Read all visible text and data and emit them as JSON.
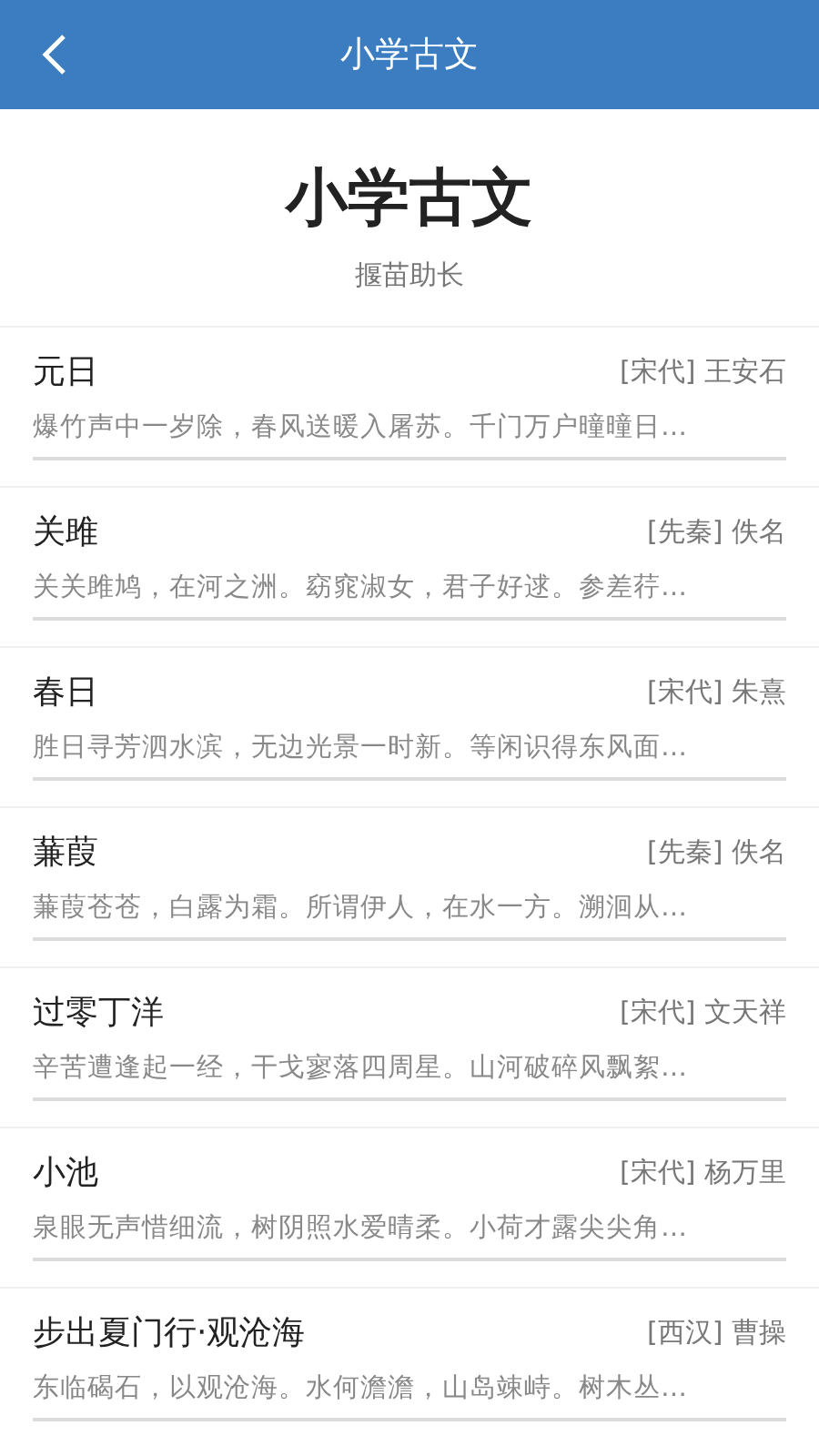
{
  "header": {
    "title": "小学古文"
  },
  "intro": {
    "title": "小学古文",
    "subtitle": "揠苗助长"
  },
  "poems": [
    {
      "title": "元日",
      "dynasty": "[宋代]",
      "author": "王安石",
      "excerpt": "爆竹声中一岁除，春风送暖入屠苏。千门万户曈曈日…"
    },
    {
      "title": "关雎",
      "dynasty": "[先秦]",
      "author": "佚名",
      "excerpt": "关关雎鸠，在河之洲。窈窕淑女，君子好逑。参差荇…"
    },
    {
      "title": "春日",
      "dynasty": "[宋代]",
      "author": "朱熹",
      "excerpt": "胜日寻芳泗水滨，无边光景一时新。等闲识得东风面…"
    },
    {
      "title": "蒹葭",
      "dynasty": "[先秦]",
      "author": "佚名",
      "excerpt": "蒹葭苍苍，白露为霜。所谓伊人，在水一方。溯洄从…"
    },
    {
      "title": "过零丁洋",
      "dynasty": "[宋代]",
      "author": "文天祥",
      "excerpt": "辛苦遭逢起一经，干戈寥落四周星。山河破碎风飘絮…"
    },
    {
      "title": "小池",
      "dynasty": "[宋代]",
      "author": "杨万里",
      "excerpt": "泉眼无声惜细流，树阴照水爱晴柔。小荷才露尖尖角…"
    },
    {
      "title": "步出夏门行·观沧海",
      "dynasty": "[西汉]",
      "author": "曹操",
      "excerpt": "东临碣石，以观沧海。水何澹澹，山岛竦峙。树木丛…"
    }
  ]
}
